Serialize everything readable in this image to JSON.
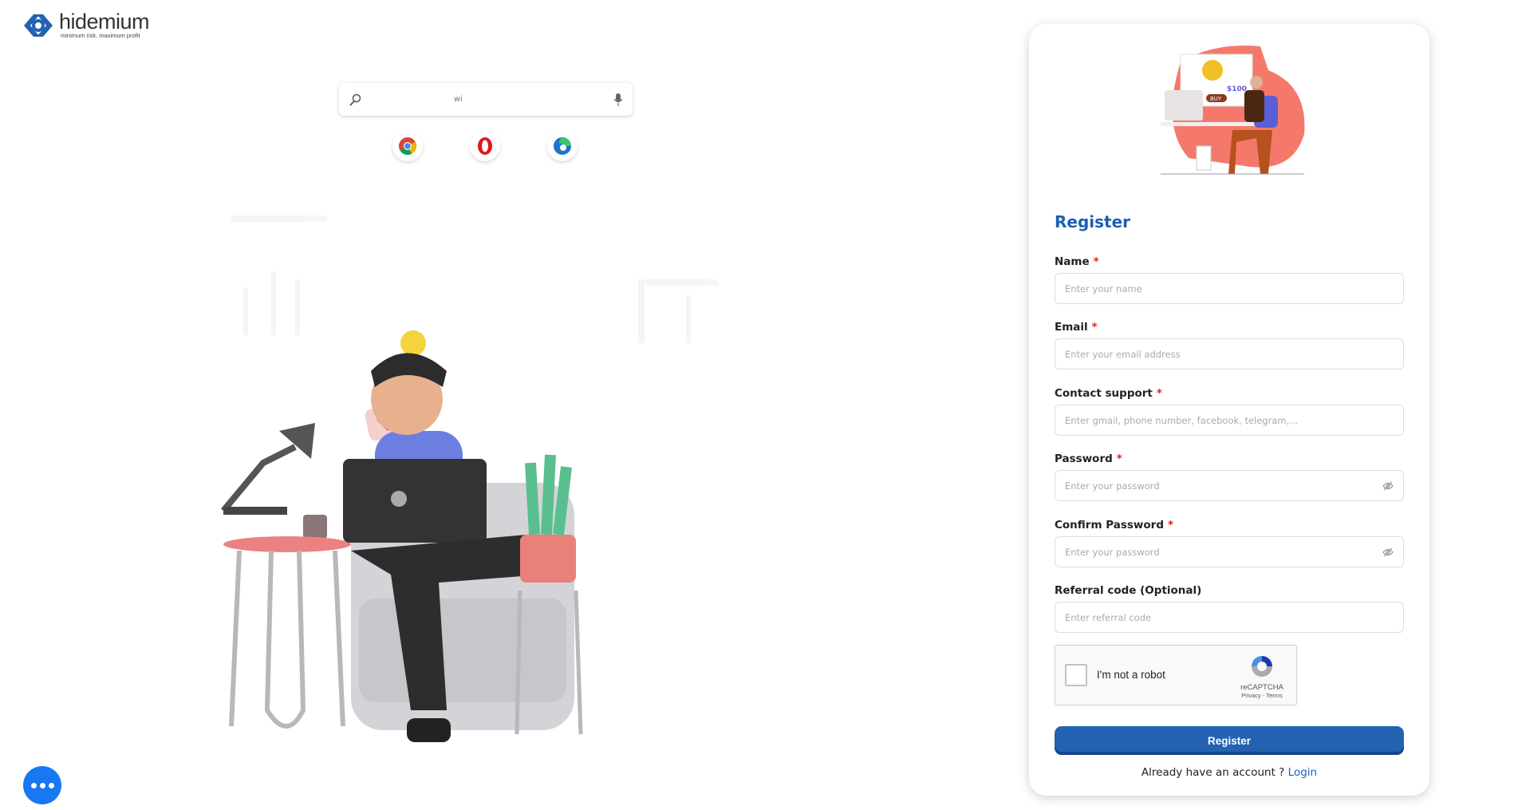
{
  "brand": {
    "name": "hidemium",
    "tagline": "minimum risk, maximum profit",
    "color": "#1d5fb3"
  },
  "search": {
    "value": "wi",
    "icons": [
      "search-icon",
      "microphone-icon"
    ]
  },
  "browsers": [
    {
      "name": "chrome"
    },
    {
      "name": "opera"
    },
    {
      "name": "edge"
    }
  ],
  "illustration": {
    "price": "$100",
    "buy": "BUY"
  },
  "form": {
    "title": "Register",
    "fields": [
      {
        "label": "Name",
        "required": "*",
        "placeholder": "Enter your name"
      },
      {
        "label": "Email",
        "required": "*",
        "placeholder": "Enter your email address"
      },
      {
        "label": "Contact support",
        "required": "*",
        "placeholder": "Enter gmail, phone number, facebook, telegram,..."
      },
      {
        "label": "Password",
        "required": "*",
        "placeholder": "Enter your password"
      },
      {
        "label": "Confirm Password",
        "required": "*",
        "placeholder": "Enter your password"
      },
      {
        "label": "Referral code (Optional)",
        "placeholder": "Enter referral code"
      }
    ],
    "captcha": {
      "text": "I'm not a robot",
      "brand": "reCAPTCHA",
      "links": "Privacy - Terms"
    },
    "submit": "Register",
    "footer": {
      "text": "Already have an account ?",
      "link": "Login"
    }
  },
  "colors": {
    "primary": "#2262b1",
    "required": "#e02020",
    "chat": "#1877f2"
  }
}
